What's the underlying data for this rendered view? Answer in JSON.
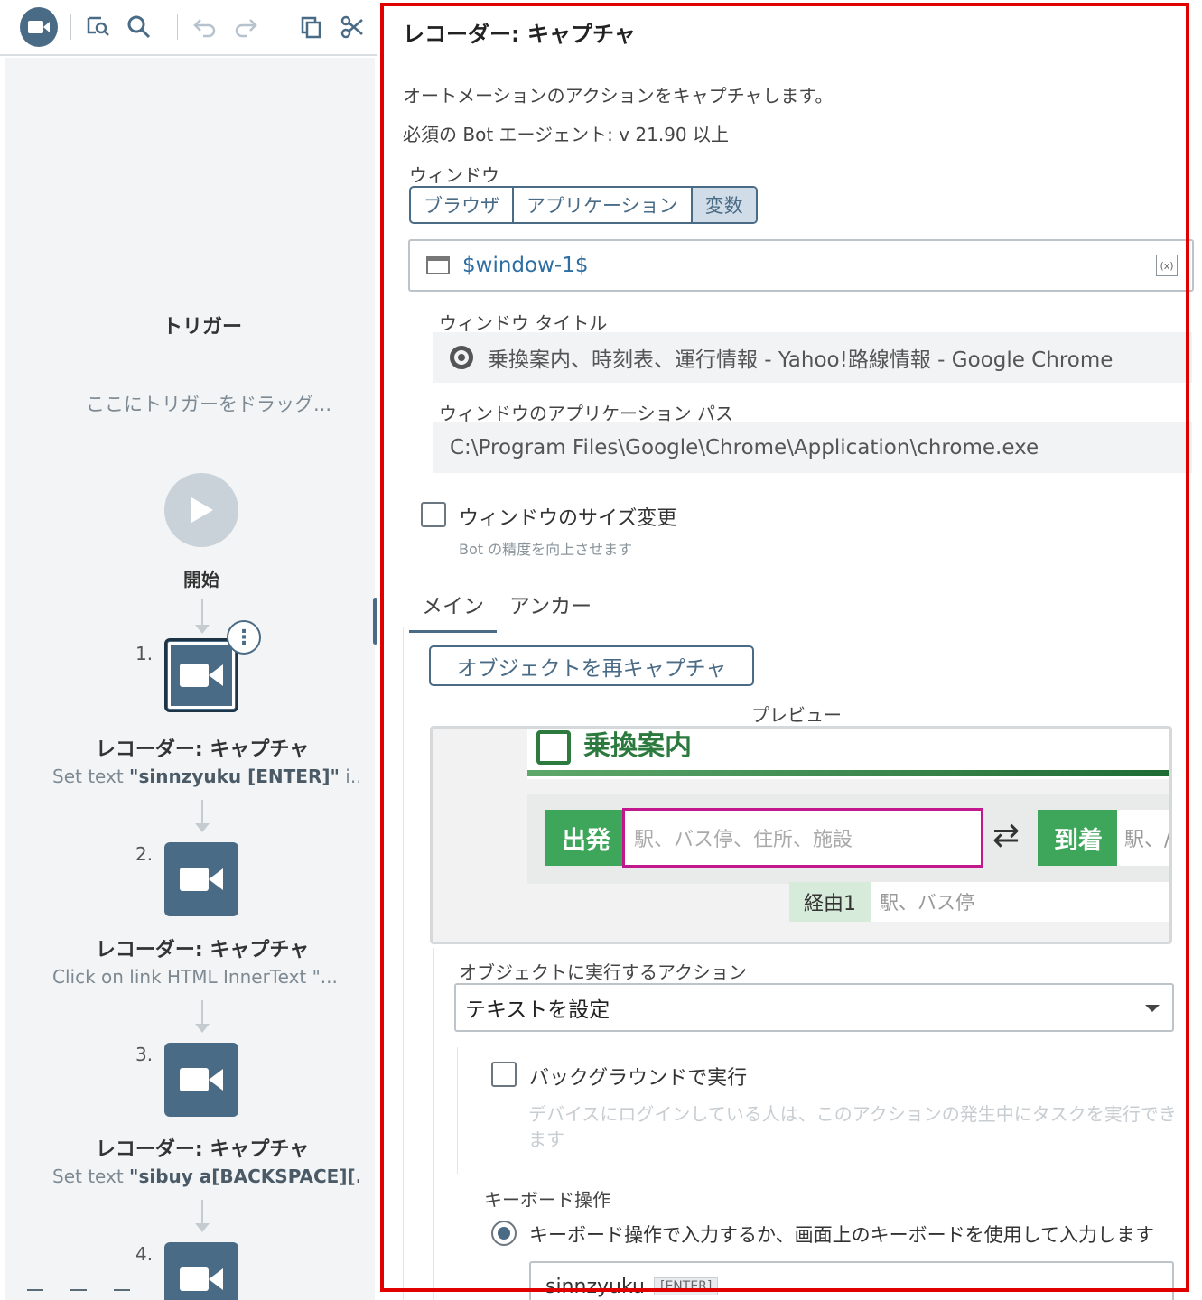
{
  "toolbar": {
    "icons": [
      "recorder-icon",
      "find-icon",
      "search-icon",
      "undo-icon",
      "redo-icon",
      "copy-icon",
      "cut-icon"
    ]
  },
  "flow": {
    "trigger_title": "トリガー",
    "trigger_drop": "ここにトリガーをドラッグ...",
    "start_label": "開始",
    "steps": [
      {
        "num": "1.",
        "title": "レコーダー: キャプチャ",
        "desc_prefix": "Set text ",
        "desc_bold": "\"sinnzyuku [ENTER]\"",
        "desc_suffix": " i..."
      },
      {
        "num": "2.",
        "title": "レコーダー: キャプチャ",
        "desc_prefix": "Click on link HTML InnerText \"...",
        "desc_bold": "",
        "desc_suffix": ""
      },
      {
        "num": "3.",
        "title": "レコーダー: キャプチャ",
        "desc_prefix": "Set text ",
        "desc_bold": "\"sibuy a[BACKSPACE][...",
        "desc_suffix": ""
      },
      {
        "num": "4."
      }
    ]
  },
  "panel": {
    "title": "レコーダー: キャプチャ",
    "description": "オートメーションのアクションをキャプチャします。",
    "requirement": "必須の Bot エージェント: v 21.90 以上",
    "window_label": "ウィンドウ",
    "window_modes": [
      "ブラウザ",
      "アプリケーション",
      "変数"
    ],
    "window_selected": "変数",
    "window_value": "$window-1$",
    "window_title_label": "ウィンドウ タイトル",
    "window_title_value": "乗換案内、時刻表、運行情報 - Yahoo!路線情報 - Google Chrome",
    "app_path_label": "ウィンドウのアプリケーション パス",
    "app_path_value": "C:\\Program Files\\Google\\Chrome\\Application\\chrome.exe",
    "resize_label": "ウィンドウのサイズ変更",
    "resize_hint": "Bot の精度を向上させます",
    "tabs": [
      "メイン",
      "アンカー"
    ],
    "active_tab": "メイン",
    "recapture_button": "オブジェクトを再キャプチャ",
    "preview_label": "プレビュー",
    "preview": {
      "header": "乗換案内",
      "departure": "出発",
      "departure_placeholder": "駅、バス停、住所、施設",
      "arrival": "到着",
      "arrival_placeholder": "駅、/",
      "via": "経由1",
      "via_placeholder": "駅、バス停"
    },
    "action_label": "オブジェクトに実行するアクション",
    "action_value": "テキストを設定",
    "background_label": "バックグラウンドで実行",
    "background_desc": "デバイスにログインしている人は、このアクションの発生中にタスクを実行できます",
    "keyboard_label": "キーボード操作",
    "keyboard_option": "キーボード操作で入力するか、画面上のキーボードを使用して入力します",
    "keyboard_value": "sinnzyuku",
    "keyboard_tag": "[ENTER]"
  },
  "colors": {
    "accent": "#4a6b86",
    "highlight": "#e00000",
    "preview_green": "#3ea65a",
    "preview_magenta": "#c2188e"
  }
}
